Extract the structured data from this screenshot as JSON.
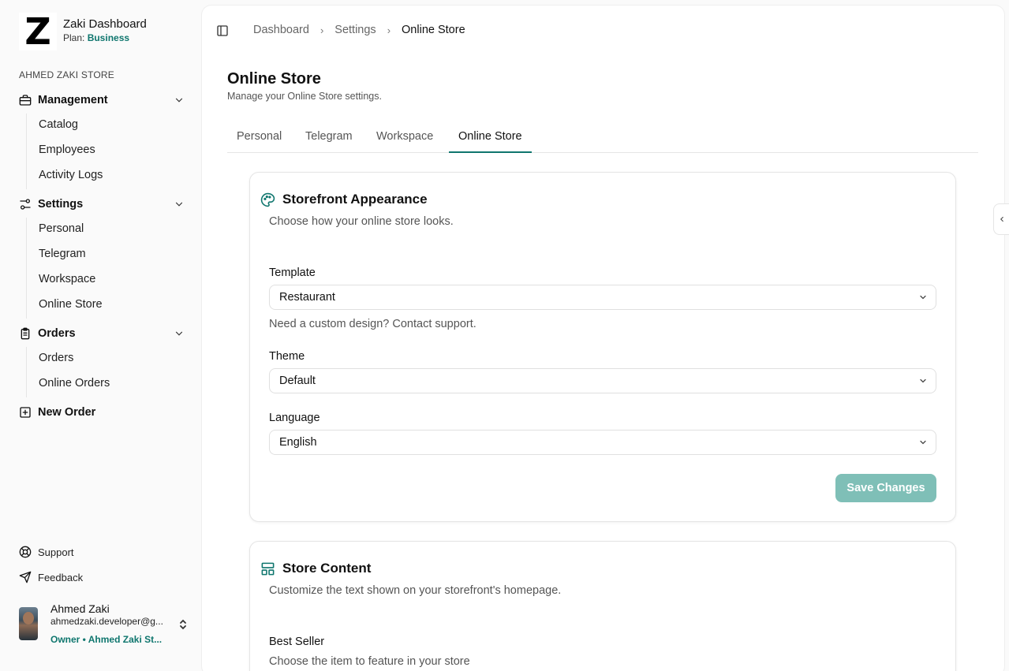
{
  "app": {
    "initial": "Z",
    "name": "Zaki Dashboard",
    "plan_prefix": "Plan: ",
    "plan_value": "Business",
    "store_label": "AHMED ZAKI STORE"
  },
  "sidebar": {
    "management": {
      "label": "Management",
      "icon": "briefcase-icon",
      "items": [
        "Catalog",
        "Employees",
        "Activity Logs"
      ]
    },
    "settings": {
      "label": "Settings",
      "icon": "settings-sliders-icon",
      "items": [
        "Personal",
        "Telegram",
        "Workspace",
        "Online Store"
      ]
    },
    "orders": {
      "label": "Orders",
      "icon": "clipboard-icon",
      "items": [
        "Orders",
        "Online Orders"
      ]
    },
    "new_order": {
      "label": "New Order",
      "icon": "plus-square-icon"
    },
    "support": {
      "label": "Support",
      "icon": "lifebuoy-icon"
    },
    "feedback": {
      "label": "Feedback",
      "icon": "send-icon"
    }
  },
  "user": {
    "name": "Ahmed Zaki",
    "email": "ahmedzaki.developer@g...",
    "role": "Owner • Ahmed Zaki St..."
  },
  "breadcrumb": [
    "Dashboard",
    "Settings",
    "Online Store"
  ],
  "page": {
    "title": "Online Store",
    "subtitle": "Manage your Online Store settings."
  },
  "tabs": [
    "Personal",
    "Telegram",
    "Workspace",
    "Online Store"
  ],
  "active_tab": "Online Store",
  "appearance_card": {
    "title": "Storefront Appearance",
    "description": "Choose how your online store looks.",
    "template_label": "Template",
    "template_value": "Restaurant",
    "template_hint": "Need a custom design? Contact support.",
    "theme_label": "Theme",
    "theme_value": "Default",
    "language_label": "Language",
    "language_value": "English",
    "save_label": "Save Changes"
  },
  "content_card": {
    "title": "Store Content",
    "description": "Customize the text shown on your storefront's homepage.",
    "best_seller_label": "Best Seller",
    "best_seller_hint": "Choose the item to feature in your store"
  },
  "colors": {
    "accent": "#0f766e",
    "button_disabled": "#7fbfb7"
  }
}
